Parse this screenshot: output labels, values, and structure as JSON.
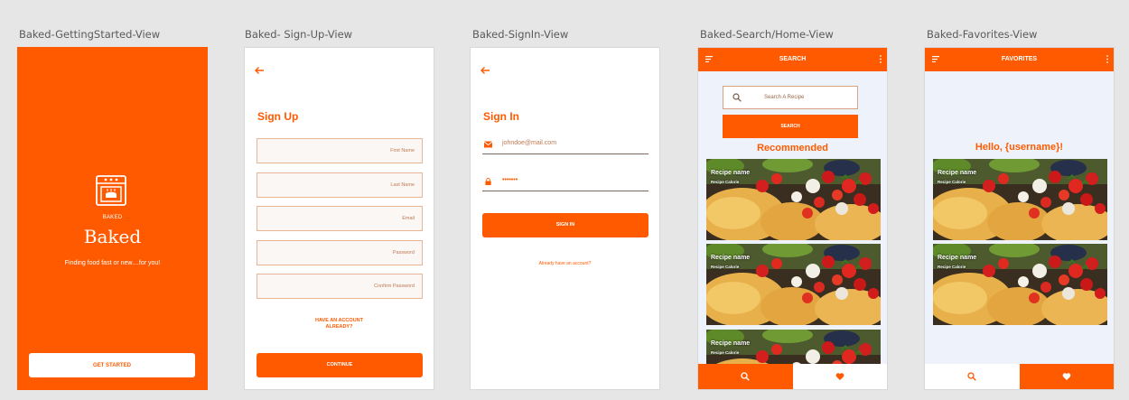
{
  "labels": {
    "getting_started": "Baked-GettingStarted-View",
    "signup": "Baked- Sign-Up-View",
    "signin": "Baked-SignIn-View",
    "search": "Baked-Search/Home-View",
    "favorites": "Baked-Favorites-View"
  },
  "getting_started": {
    "brand_small": "BAKED",
    "title": "Baked",
    "tagline": "Finding food fast or new....for you!",
    "button": "GET STARTED"
  },
  "signup": {
    "title": "Sign Up",
    "fields": [
      "First Name",
      "Last Name",
      "Email",
      "Password",
      "Confirm Password"
    ],
    "have_account_line1": "HAVE AN ACCOUNT",
    "have_account_line2": "ALREADY?",
    "button": "CONTINUE"
  },
  "signin": {
    "title": "Sign In",
    "email": "johndoe@mail.com",
    "password": "•••••••",
    "button": "SIGN IN",
    "already": "Already have an account?"
  },
  "search": {
    "header": "SEARCH",
    "placeholder": "Search A Recipe",
    "button": "SEARCH",
    "section": "Recommended",
    "cards": [
      {
        "name": "Recipe name",
        "cal": "Recipe Calorie"
      },
      {
        "name": "Recipe name",
        "cal": "Recipe Calorie"
      },
      {
        "name": "Recipe name",
        "cal": "Recipe Calorie"
      }
    ]
  },
  "favorites": {
    "header": "FAVORITES",
    "greeting": "Hello, {username}!",
    "cards": [
      {
        "name": "Recipe name",
        "cal": "Recipe Calorie"
      },
      {
        "name": "Recipe name",
        "cal": "Recipe Calorie"
      }
    ]
  },
  "colors": {
    "accent": "#ff5a00",
    "artboard_bg": "#e6e6e6",
    "app_bg": "#eef3fb"
  }
}
